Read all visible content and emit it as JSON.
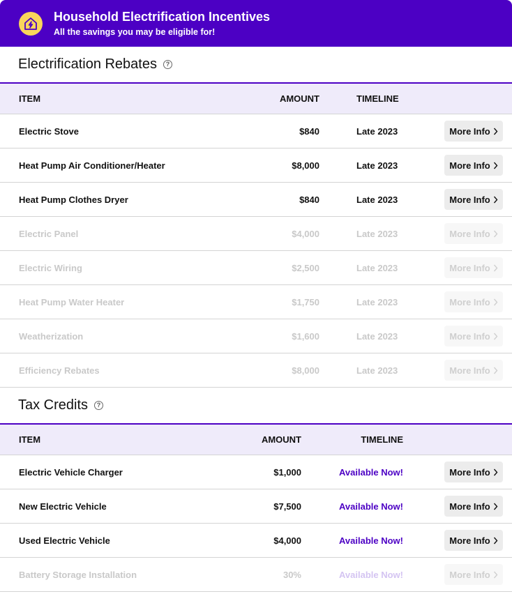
{
  "header": {
    "title": "Household Electrification Incentives",
    "subtitle": "All the savings you may be eligible for!",
    "icon": "house-lightning-icon"
  },
  "colors": {
    "brand": "#4c00c4",
    "icon_bg": "#f9d65b",
    "header_row_bg": "#efebfa"
  },
  "rebates": {
    "title": "Electrification Rebates",
    "columns": {
      "item": "ITEM",
      "amount": "AMOUNT",
      "timeline": "TIMELINE"
    },
    "rows": [
      {
        "item": "Electric Stove",
        "amount": "$840",
        "timeline": "Late 2023",
        "button": "More Info",
        "eligible": true
      },
      {
        "item": "Heat Pump Air Conditioner/Heater",
        "amount": "$8,000",
        "timeline": "Late 2023",
        "button": "More Info",
        "eligible": true
      },
      {
        "item": "Heat Pump Clothes Dryer",
        "amount": "$840",
        "timeline": "Late 2023",
        "button": "More Info",
        "eligible": true
      },
      {
        "item": "Electric Panel",
        "amount": "$4,000",
        "timeline": "Late 2023",
        "button": "More Info",
        "eligible": false
      },
      {
        "item": "Electric Wiring",
        "amount": "$2,500",
        "timeline": "Late 2023",
        "button": "More Info",
        "eligible": false
      },
      {
        "item": "Heat Pump Water Heater",
        "amount": "$1,750",
        "timeline": "Late 2023",
        "button": "More Info",
        "eligible": false
      },
      {
        "item": "Weatherization",
        "amount": "$1,600",
        "timeline": "Late 2023",
        "button": "More Info",
        "eligible": false
      },
      {
        "item": "Efficiency Rebates",
        "amount": "$8,000",
        "timeline": "Late 2023",
        "button": "More Info",
        "eligible": false
      }
    ]
  },
  "credits": {
    "title": "Tax Credits",
    "columns": {
      "item": "ITEM",
      "amount": "AMOUNT",
      "timeline": "TIMELINE"
    },
    "rows": [
      {
        "item": "Electric Vehicle Charger",
        "amount": "$1,000",
        "timeline": "Available Now!",
        "button": "More Info",
        "eligible": true
      },
      {
        "item": "New Electric Vehicle",
        "amount": "$7,500",
        "timeline": "Available Now!",
        "button": "More Info",
        "eligible": true
      },
      {
        "item": "Used Electric Vehicle",
        "amount": "$4,000",
        "timeline": "Available Now!",
        "button": "More Info",
        "eligible": true
      },
      {
        "item": "Battery Storage Installation",
        "amount": "30%",
        "timeline": "Available Now!",
        "button": "More Info",
        "eligible": false
      }
    ]
  }
}
